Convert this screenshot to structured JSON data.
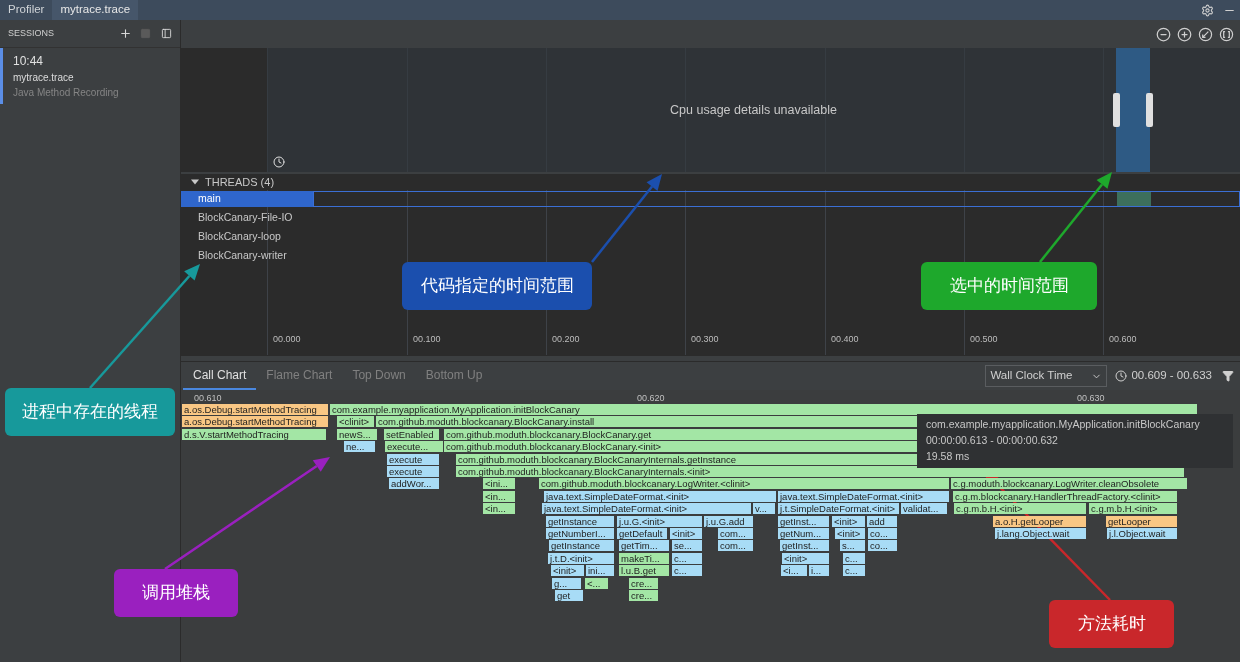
{
  "window_tabs": [
    {
      "label": "Profiler",
      "selected": false
    },
    {
      "label": "mytrace.trace",
      "selected": true
    }
  ],
  "sessions": {
    "title": "SESSIONS",
    "items": [
      {
        "time": "10:44",
        "name": "mytrace.trace",
        "type": "Java Method Recording",
        "selected": true
      }
    ]
  },
  "cpu": {
    "message": "Cpu usage details unavailable"
  },
  "threads": {
    "title": "THREADS (4)",
    "expanded": true,
    "items": [
      {
        "name": "main",
        "selected": true
      },
      {
        "name": "BlockCanary-File-IO",
        "selected": false
      },
      {
        "name": "BlockCanary-loop",
        "selected": false
      },
      {
        "name": "BlockCanary-writer",
        "selected": false
      }
    ]
  },
  "axis_ticks": [
    "00.000",
    "00.100",
    "00.200",
    "00.300",
    "00.400",
    "00.500",
    "00.600"
  ],
  "analysis_tabs": [
    {
      "label": "Call Chart",
      "selected": true
    },
    {
      "label": "Flame Chart",
      "selected": false
    },
    {
      "label": "Top Down",
      "selected": false
    },
    {
      "label": "Bottom Up",
      "selected": false
    }
  ],
  "clock_mode": "Wall Clock Time",
  "range": "00.609 - 00.633",
  "call_chart": {
    "ticks": [
      "00.610",
      "00.620",
      "00.630"
    ],
    "depths": [
      [
        {
          "label": "a.os.Debug.startMethodTracing",
          "kind": "android"
        },
        {
          "label": "com.example.myapplication.MyApplication.initBlockCanary",
          "kind": "app"
        }
      ],
      [
        {
          "label": "a.os.Debug.startMethodTracing",
          "kind": "android"
        },
        {
          "label": "<clinit>",
          "kind": "app"
        },
        {
          "label": "com.github.moduth.blockcanary.BlockCanary.install",
          "kind": "app"
        }
      ],
      [
        {
          "label": "d.s.V.startMethodTracing",
          "kind": "app"
        },
        {
          "label": "newS...",
          "kind": "app"
        },
        {
          "label": "setEnabled",
          "kind": "app"
        },
        {
          "label": "com.github.moduth.blockcanary.BlockCanary.get",
          "kind": "app"
        }
      ],
      [
        {
          "label": "ne...",
          "kind": "java"
        },
        {
          "label": "execute...",
          "kind": "app"
        },
        {
          "label": "com.github.moduth.blockcanary.BlockCanary.<init>",
          "kind": "app"
        }
      ],
      [
        {
          "label": "execute",
          "kind": "java"
        },
        {
          "label": "com.github.moduth.blockcanary.BlockCanaryInternals.getInstance",
          "kind": "app"
        }
      ],
      [
        {
          "label": "execute",
          "kind": "java"
        },
        {
          "label": "com.github.moduth.blockcanary.BlockCanaryInternals.<init>",
          "kind": "app"
        }
      ],
      [
        {
          "label": "addWor...",
          "kind": "java"
        },
        {
          "label": "<ini...",
          "kind": "app"
        },
        {
          "label": "com.github.moduth.blockcanary.LogWriter.<clinit>",
          "kind": "app"
        },
        {
          "label": "c.g.moduth.blockcanary.LogWriter.cleanObsolete",
          "kind": "app"
        }
      ],
      [
        {
          "label": "<in...",
          "kind": "app"
        },
        {
          "label": "java.text.SimpleDateFormat.<init>",
          "kind": "java"
        },
        {
          "label": "java.text.SimpleDateFormat.<init>",
          "kind": "java"
        },
        {
          "label": "c.g.m.blockcanary.HandlerThreadFactory.<clinit>",
          "kind": "app"
        }
      ],
      [
        {
          "label": "<in...",
          "kind": "app"
        },
        {
          "label": "java.text.SimpleDateFormat.<init>",
          "kind": "java"
        },
        {
          "label": "v...",
          "kind": "java"
        },
        {
          "label": "j.t.SimpleDateFormat.<init>",
          "kind": "java"
        },
        {
          "label": "validat...",
          "kind": "java"
        },
        {
          "label": "c.g.m.b.H.<init>",
          "kind": "app"
        },
        {
          "label": "c.g.m.b.H.<init>",
          "kind": "app"
        }
      ],
      [
        {
          "label": "getInstance",
          "kind": "java"
        },
        {
          "label": "j.u.G.<init>",
          "kind": "java"
        },
        {
          "label": "j.u.G.add",
          "kind": "java"
        },
        {
          "label": "getInst...",
          "kind": "java"
        },
        {
          "label": "<init>",
          "kind": "java"
        },
        {
          "label": "add",
          "kind": "java"
        },
        {
          "label": "a.o.H.getLooper",
          "kind": "android"
        },
        {
          "label": "getLooper",
          "kind": "android"
        }
      ],
      [
        {
          "label": "getNumberI...",
          "kind": "java"
        },
        {
          "label": "getDefault",
          "kind": "java"
        },
        {
          "label": "<init>",
          "kind": "java"
        },
        {
          "label": "com...",
          "kind": "java"
        },
        {
          "label": "getNum...",
          "kind": "java"
        },
        {
          "label": "<init>",
          "kind": "java"
        },
        {
          "label": "co...",
          "kind": "java"
        },
        {
          "label": "j.lang.Object.wait",
          "kind": "java"
        },
        {
          "label": "j.l.Object.wait",
          "kind": "java"
        }
      ],
      [
        {
          "label": "getInstance",
          "kind": "java"
        },
        {
          "label": "getTim...",
          "kind": "java"
        },
        {
          "label": "se...",
          "kind": "java"
        },
        {
          "label": "com...",
          "kind": "java"
        },
        {
          "label": "getInst...",
          "kind": "java"
        },
        {
          "label": "s...",
          "kind": "java"
        },
        {
          "label": "co...",
          "kind": "java"
        }
      ],
      [
        {
          "label": "j.t.D.<init>",
          "kind": "java"
        },
        {
          "label": "makeTi...",
          "kind": "app"
        },
        {
          "label": "c...",
          "kind": "java"
        },
        {
          "label": "<init>",
          "kind": "java"
        },
        {
          "label": "c...",
          "kind": "java"
        }
      ],
      [
        {
          "label": "<init>",
          "kind": "java"
        },
        {
          "label": "ini...",
          "kind": "java"
        },
        {
          "label": "l.u.B.get",
          "kind": "app"
        },
        {
          "label": "c...",
          "kind": "java"
        },
        {
          "label": "<i...",
          "kind": "java"
        },
        {
          "label": "i...",
          "kind": "java"
        },
        {
          "label": "c...",
          "kind": "java"
        }
      ],
      [
        {
          "label": "g...",
          "kind": "java"
        },
        {
          "label": "<...",
          "kind": "app"
        },
        {
          "label": "cre...",
          "kind": "app"
        }
      ],
      [
        {
          "label": "get",
          "kind": "java"
        },
        {
          "label": "cre...",
          "kind": "app"
        }
      ]
    ]
  },
  "tooltip": {
    "method": "com.example.myapplication.MyApplication.initBlockCanary",
    "time_range": "00:00:00.613 - 00:00:00.632",
    "duration": "19.58 ms"
  },
  "annotations": [
    {
      "text": "代码指定的时间范围",
      "color": "#1b4fae"
    },
    {
      "text": "选中的时间范围",
      "color": "#1ea82c"
    },
    {
      "text": "进程中存在的线程",
      "color": "#17999b"
    },
    {
      "text": "调用堆栈",
      "color": "#9a20bf"
    },
    {
      "text": "方法耗时",
      "color": "#c9272b"
    }
  ]
}
